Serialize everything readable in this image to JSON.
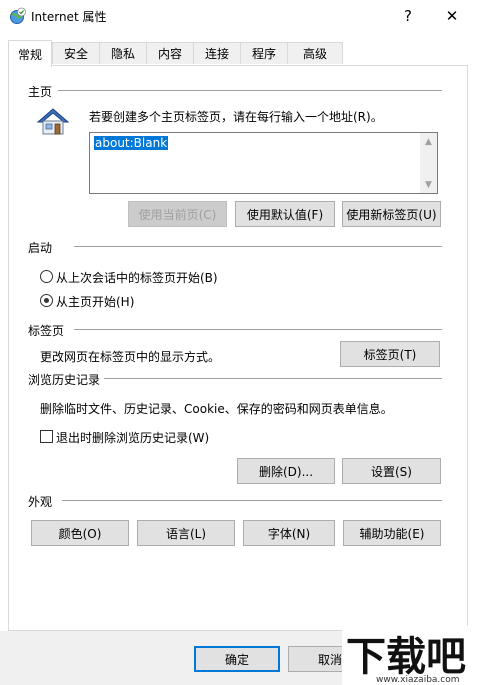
{
  "window": {
    "title": "Internet 属性",
    "help_label": "?",
    "close_label": "✕"
  },
  "tabs": [
    {
      "label": "常规",
      "active": true
    },
    {
      "label": "安全"
    },
    {
      "label": "隐私"
    },
    {
      "label": "内容"
    },
    {
      "label": "连接"
    },
    {
      "label": "程序"
    },
    {
      "label": "高级"
    }
  ],
  "homepage": {
    "group_label": "主页",
    "description": "若要创建多个主页标签页，请在每行输入一个地址(R)。",
    "address_value": "about:Blank",
    "use_current_label": "使用当前页(C)",
    "use_default_label": "使用默认值(F)",
    "use_new_tab_label": "使用新标签页(U)"
  },
  "startup": {
    "group_label": "启动",
    "option_last_session": "从上次会话中的标签页开始(B)",
    "option_home_page": "从主页开始(H)",
    "selected": "home_page"
  },
  "tabs_section": {
    "group_label": "标签页",
    "description": "更改网页在标签页中的显示方式。",
    "button_label": "标签页(T)"
  },
  "history": {
    "group_label": "浏览历史记录",
    "description": "删除临时文件、历史记录、Cookie、保存的密码和网页表单信息。",
    "delete_on_exit_label": "退出时删除浏览历史记录(W)",
    "delete_on_exit_checked": false,
    "delete_label": "删除(D)...",
    "settings_label": "设置(S)"
  },
  "appearance": {
    "group_label": "外观",
    "colors_label": "颜色(O)",
    "languages_label": "语言(L)",
    "fonts_label": "字体(N)",
    "accessibility_label": "辅助功能(E)"
  },
  "footer": {
    "ok_label": "确定",
    "cancel_label": "取消"
  },
  "watermark": {
    "logo_text": "下载吧",
    "url_text": "www.xiazaiba.com"
  },
  "colors": {
    "accent": "#0078d7",
    "house_roof": "#3a6fc4"
  }
}
